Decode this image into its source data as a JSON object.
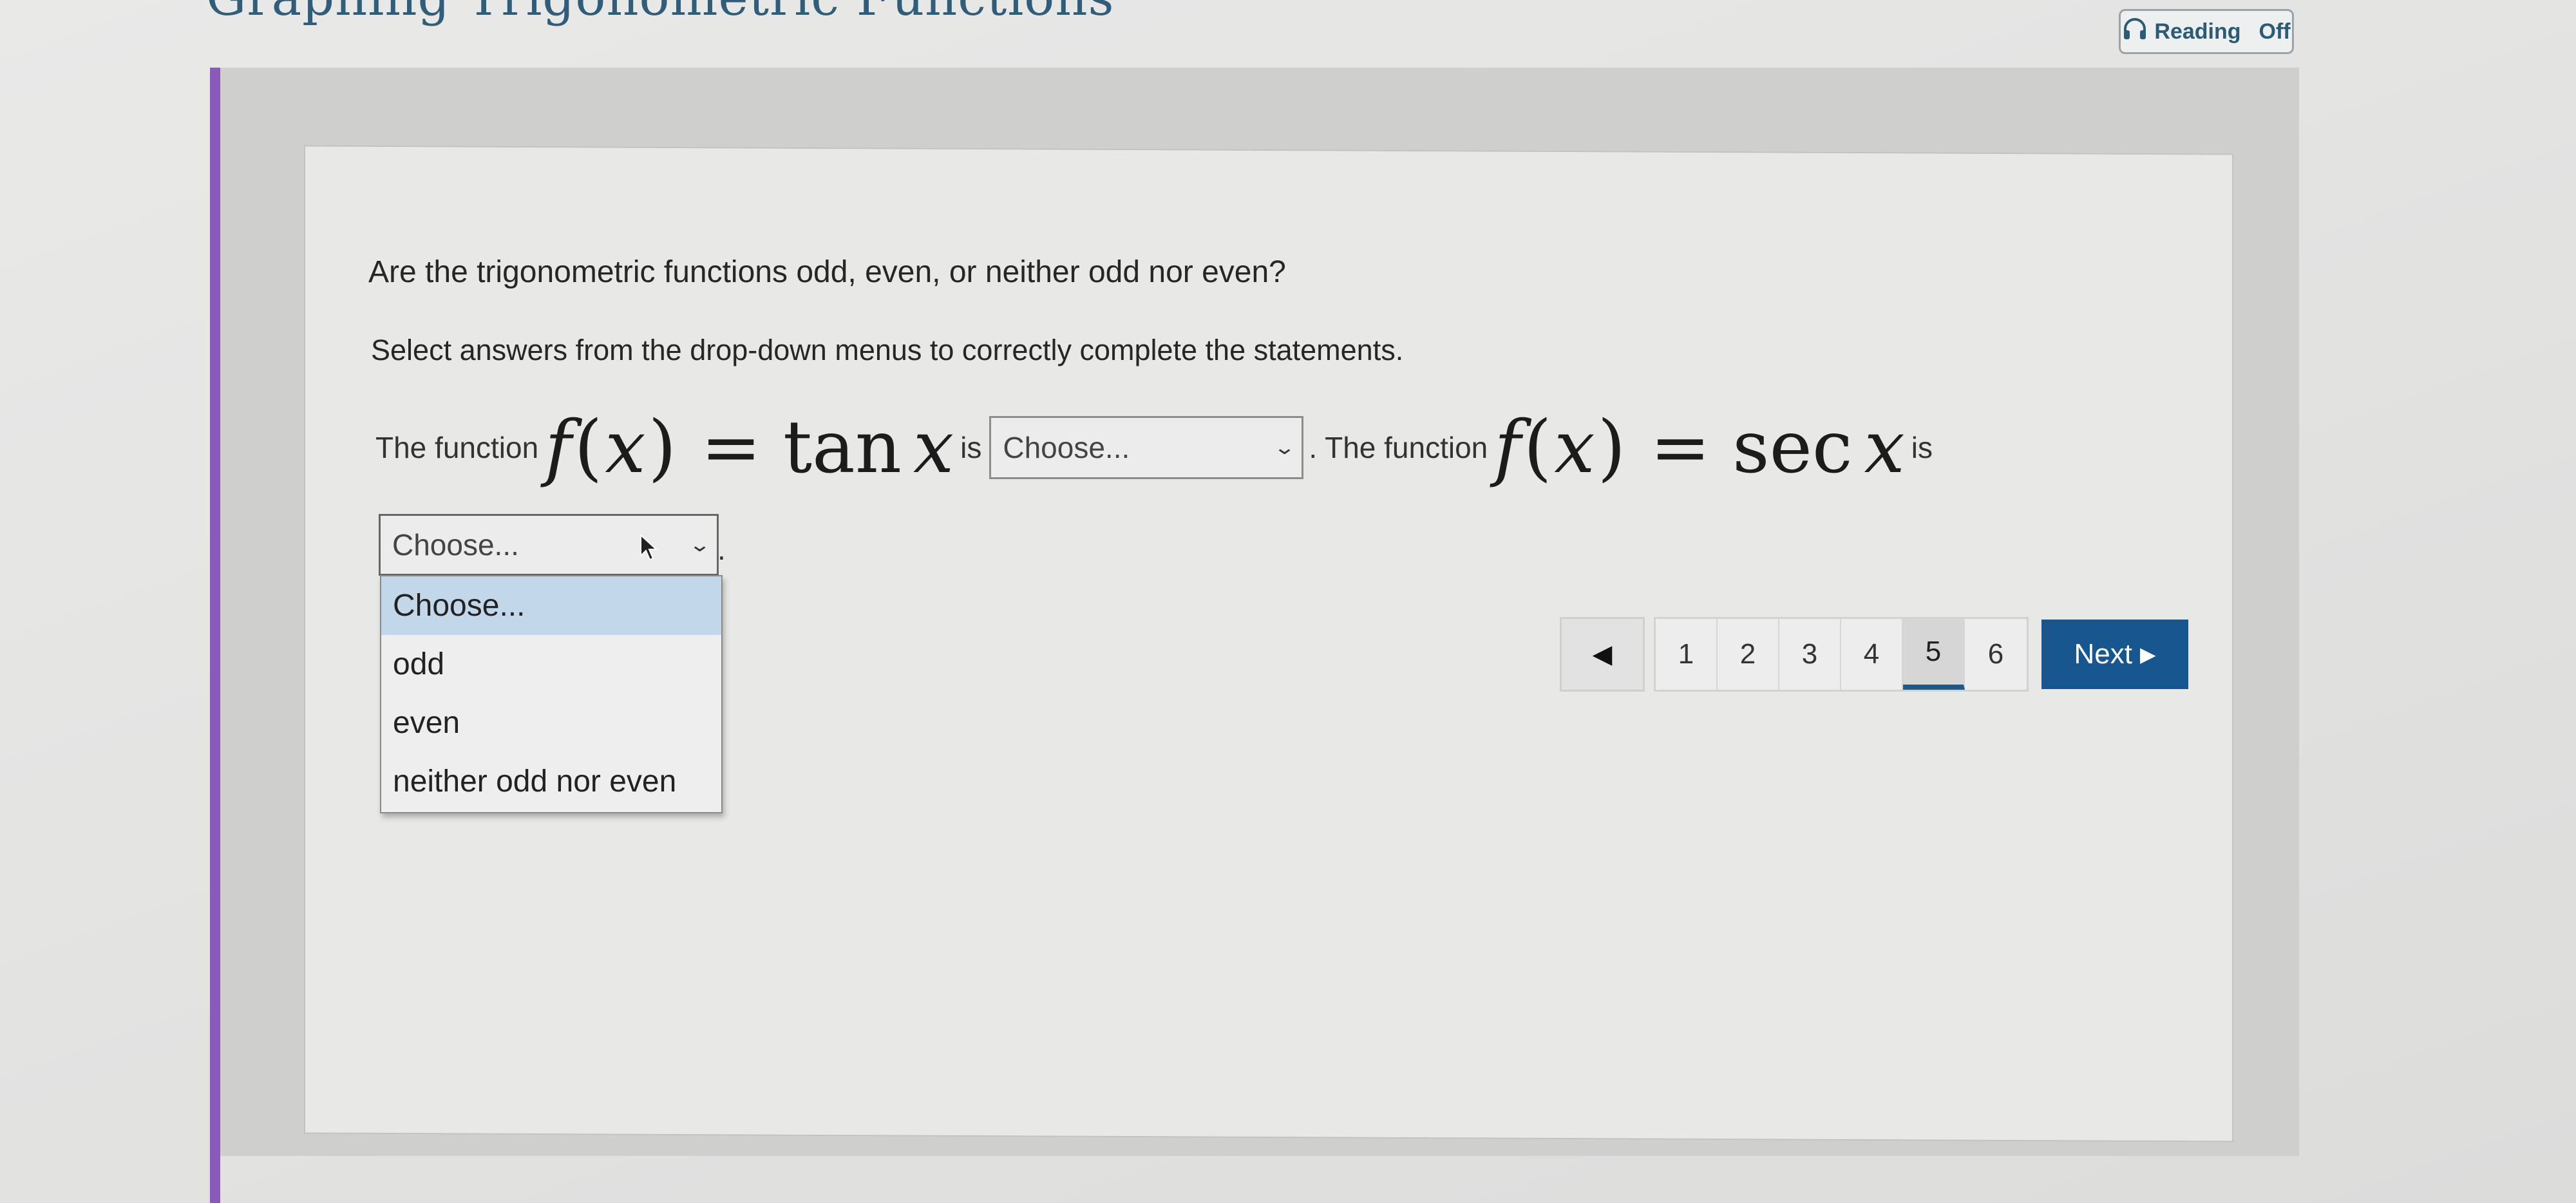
{
  "header": {
    "title": "Graphing Trigonometric Functions",
    "reading_label": "Reading",
    "reading_state": "Off"
  },
  "question": {
    "prompt": "Are the trigonometric functions odd, even, or neither odd nor even?",
    "instructions": "Select answers from the drop-down menus to correctly complete the statements.",
    "statement_prefix": "The function",
    "statement_is": "is",
    "function_1": {
      "lhs": "f",
      "var": "x",
      "fn": "tan",
      "arg": "x"
    },
    "function_2": {
      "lhs": "f",
      "var": "x",
      "fn": "sec",
      "arg": "x"
    },
    "statement_period_prefix": ". The function",
    "period": "."
  },
  "dropdown_1": {
    "value": "Choose..."
  },
  "dropdown_2": {
    "value": "Choose...",
    "options": [
      "Choose...",
      "odd",
      "even",
      "neither odd nor even"
    ],
    "highlighted_index": 0
  },
  "pagination": {
    "prev_icon": "◀",
    "pages": [
      "1",
      "2",
      "3",
      "4",
      "5",
      "6"
    ],
    "current_page": "5",
    "next_label": "Next",
    "next_icon": "▶"
  },
  "colors": {
    "accent_bar": "#8a5ab8",
    "next_button": "#17568e",
    "title": "#2f5d7a",
    "option_highlight": "#c3d7ea"
  },
  "icons": [
    "headphones-icon",
    "chevron-down-icon",
    "cursor-icon",
    "triangle-left-icon",
    "triangle-right-icon"
  ]
}
